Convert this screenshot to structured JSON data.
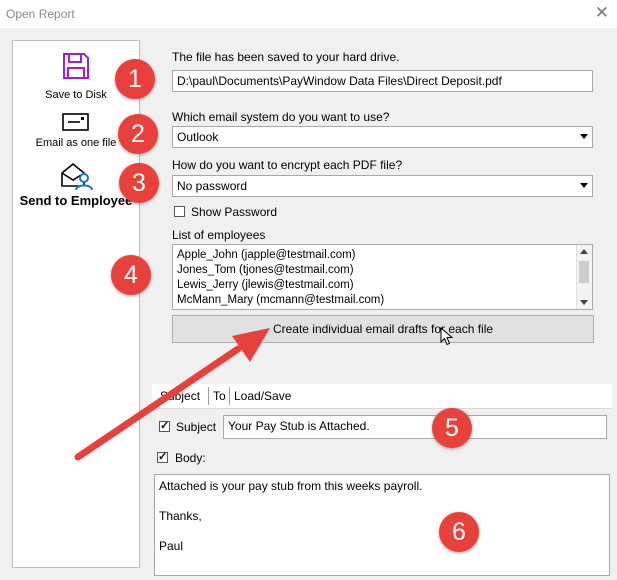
{
  "window": {
    "title": "Open Report"
  },
  "sidebar": {
    "items": [
      {
        "label": "Save to Disk"
      },
      {
        "label": "Email as one file"
      },
      {
        "label": "Send to Employee"
      }
    ]
  },
  "form": {
    "saved_label": "The file has been saved to your hard drive.",
    "file_path": "D:\\paul\\Documents\\PayWindow Data Files\\Direct Deposit.pdf",
    "email_system_label": "Which email system do you want to use?",
    "email_system_value": "Outlook",
    "encrypt_label": "How do you want to encrypt each PDF file?",
    "encrypt_value": "No password",
    "show_password_label": "Show Password",
    "employees_label": "List of employees",
    "employees": [
      "Apple_John (japple@testmail.com)",
      "Jones_Tom (tjones@testmail.com)",
      "Lewis_Jerry (jlewis@testmail.com)",
      "McMann_Mary (mcmann@testmail.com)"
    ],
    "create_button": "Create individual email drafts for each file"
  },
  "tabs": {
    "subject": "Subject",
    "to": "To",
    "load_save": "Load/Save"
  },
  "email": {
    "subject_label": "Subject",
    "subject_value": "Your Pay Stub is Attached.",
    "body_label": "Body:",
    "body_lines": [
      "Attached is your pay stub from this weeks payroll.",
      "",
      "Thanks,",
      "",
      "Paul"
    ]
  },
  "badges": [
    "1",
    "2",
    "3",
    "4",
    "5",
    "6"
  ],
  "colors": {
    "badge": "#e8413c",
    "arrow": "#e8413c",
    "save_icon": "#a020c8",
    "employee_icon": "#1e73c8"
  }
}
